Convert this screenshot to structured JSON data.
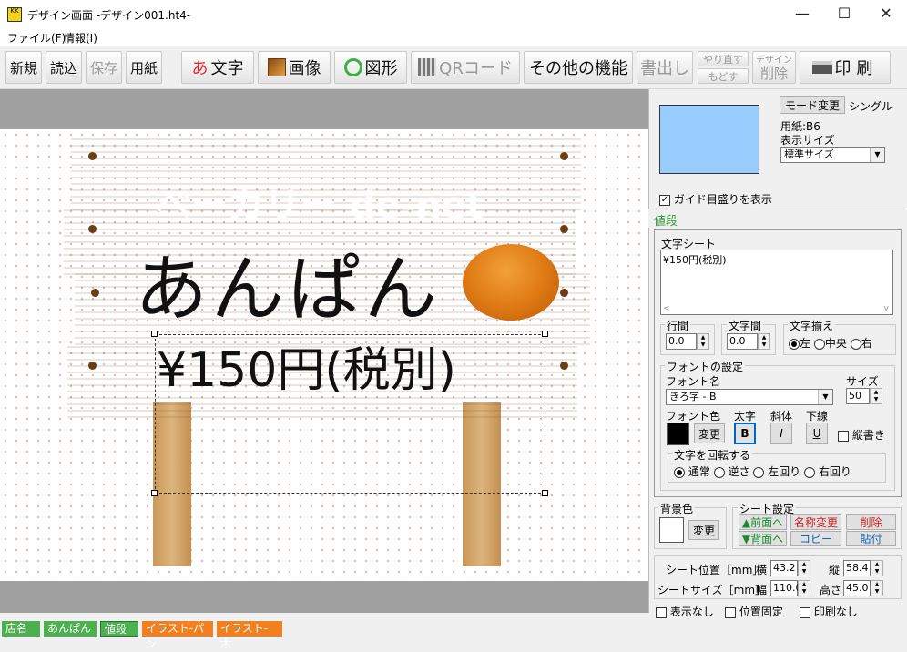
{
  "window": {
    "title": "デザイン画面 -デザイン001.ht4-",
    "icon_label": "KK",
    "minimize": "—",
    "maximize": "☐",
    "close": "✕"
  },
  "menu": [
    "ファイル(F)",
    "情報(I)"
  ],
  "toolbar": {
    "new": "新規",
    "open": "読込",
    "save": "保存",
    "paper": "用紙",
    "text_icon": "あ",
    "text": "文字",
    "image": "画像",
    "shape": "図形",
    "qr": "QRコード",
    "other": "その他の機能",
    "export": "書出し",
    "redo": "やり直す",
    "undo": "もどす",
    "delete_small": "デザイン",
    "delete": "削除",
    "print": "印刷"
  },
  "canvas": {
    "sign_title": "ベーカリー de-net",
    "sign_product": "あんぱん",
    "sign_price": "¥150円(税別)"
  },
  "panel": {
    "mode_button": "モード変更",
    "mode_value": "シングル",
    "paper_label": "用紙:B6",
    "display_size_label": "表示サイズ",
    "display_size_value": "標準サイズ",
    "guide_checkbox": "ガイド目盛りを表示",
    "selected_sheet_name": "値段",
    "text_sheet_label": "文字シート",
    "text_sheet_value": "¥150円(税別)",
    "line_spacing_label": "行間",
    "line_spacing_value": "0.0",
    "char_spacing_label": "文字間",
    "char_spacing_value": "0.0",
    "align_label": "文字揃え",
    "align_left": "左",
    "align_center": "中央",
    "align_right": "右",
    "font_settings_label": "フォントの設定",
    "font_name_label": "フォント名",
    "font_name_value": "きろ字 - B",
    "size_label": "サイズ",
    "size_value": "50",
    "font_color_label": "フォント色",
    "change_button": "変更",
    "bold_label": "太字",
    "bold_btn": "B",
    "italic_label": "斜体",
    "italic_btn": "I",
    "underline_label": "下線",
    "underline_btn": "U",
    "vertical_label": "縦書き",
    "rotate_label": "文字を回転する",
    "rotate_normal": "通常",
    "rotate_reverse": "逆さ",
    "rotate_left": "左回り",
    "rotate_right": "右回り",
    "bg_color_label": "背景色",
    "bg_change_button": "変更",
    "sheet_settings_label": "シート設定",
    "front_button": "▲前面へ",
    "back_button": "▼背面へ",
    "rename_button": "名称変更",
    "copy_button": "コピー",
    "delete_button": "削除",
    "paste_button": "貼付",
    "pos_label": "シート位置［mm］",
    "pos_x_label": "横",
    "pos_x_value": "43.2",
    "pos_y_label": "縦",
    "pos_y_value": "58.4",
    "size_mm_label": "シートサイズ［mm］",
    "width_label": "幅",
    "width_value": "110.0",
    "height_label": "高さ",
    "height_value": "45.0",
    "hide_label": "表示なし",
    "lock_label": "位置固定",
    "noprint_label": "印刷なし"
  },
  "tabs": [
    {
      "label": "店名",
      "color": "#4caf50"
    },
    {
      "label": "あんぱん",
      "color": "#4caf50"
    },
    {
      "label": "値段",
      "color": "#4caf50"
    },
    {
      "label": "イラスト-パン",
      "color": "#f08020"
    },
    {
      "label": "イラスト-木",
      "color": "#f08020"
    }
  ],
  "colors": {
    "preview": "#99ccff",
    "font_color": "#000000",
    "bg_color": "#ffffff",
    "selected_tab_text": "#2e9d3a"
  }
}
